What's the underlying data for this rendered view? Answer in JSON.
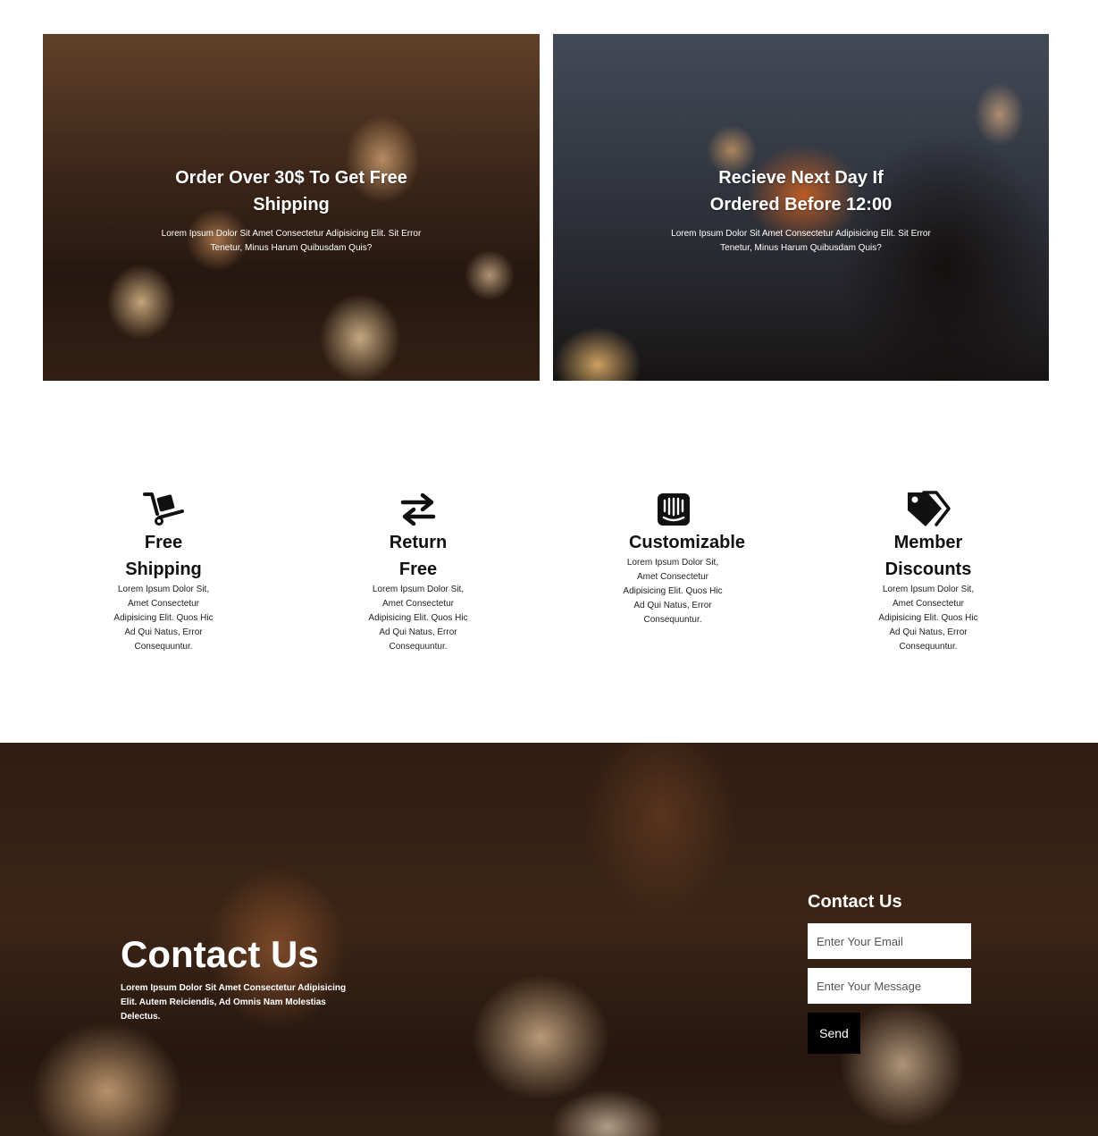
{
  "banners": [
    {
      "title": "Order Over 30$ To Get Free Shipping",
      "text": "Lorem Ipsum Dolor Sit Amet Consectetur Adipisicing Elit. Sit Error Tenetur, Minus Harum Quibusdam Quis?"
    },
    {
      "title": "Recieve Next Day If Ordered Before 12:00",
      "text": "Lorem Ipsum Dolor Sit Amet Consectetur Adipisicing Elit. Sit Error Tenetur, Minus Harum Quibusdam Quis?"
    }
  ],
  "features": [
    {
      "icon": "dolly-icon",
      "title": "Free Shipping",
      "text": "Lorem Ipsum Dolor Sit, Amet Consectetur Adipisicing Elit. Quos Hic Ad Qui Natus, Error Consequuntur."
    },
    {
      "icon": "exchange-arrows-icon",
      "title": "Return Free",
      "text": "Lorem Ipsum Dolor Sit, Amet Consectetur Adipisicing Elit. Quos Hic Ad Qui Natus, Error Consequuntur."
    },
    {
      "icon": "intercom-icon",
      "title": "Customizable",
      "text": "Lorem Ipsum Dolor Sit, Amet Consectetur Adipisicing Elit. Quos Hic Ad Qui Natus, Error Consequuntur."
    },
    {
      "icon": "tags-icon",
      "title": "Member Discounts",
      "text": "Lorem Ipsum Dolor Sit, Amet Consectetur Adipisicing Elit. Quos Hic Ad Qui Natus, Error Consequuntur."
    }
  ],
  "contact": {
    "heading": "Contact Us",
    "text": "Lorem Ipsum Dolor Sit Amet Consectetur Adipisicing Elit. Autem Reiciendis, Ad Omnis Nam Molestias Delectus.",
    "form": {
      "title": "Contact Us",
      "email_placeholder": "Enter Your Email",
      "message_placeholder": "Enter Your Message",
      "send_label": "Send"
    }
  },
  "colors": {
    "button": "#000000",
    "text_dark": "#111111",
    "text_light": "#ffffff"
  }
}
